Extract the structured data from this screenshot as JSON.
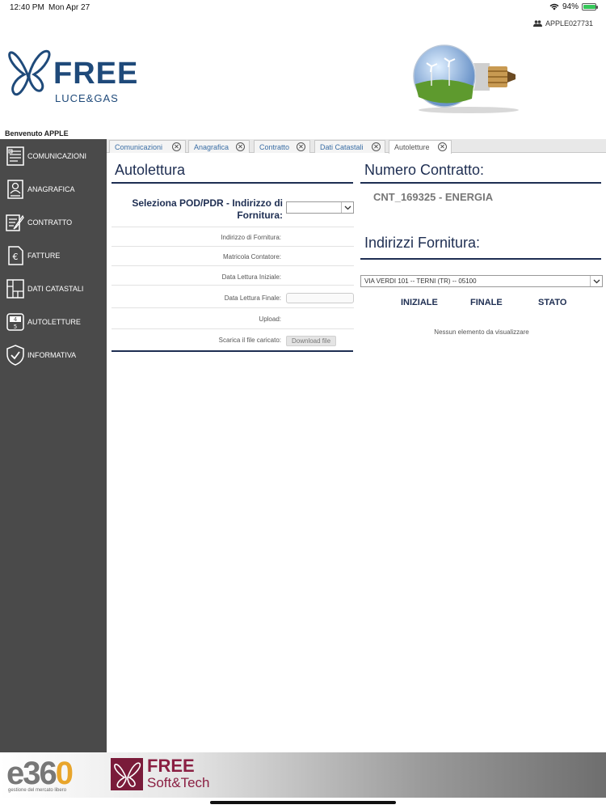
{
  "status_bar": {
    "time": "12:40 PM",
    "date": "Mon Apr 27",
    "battery": "94%",
    "battery_level": 0.94
  },
  "header": {
    "user_id": "APPLE027731",
    "brand_name": "FREE",
    "brand_tagline": "LUCE&GAS",
    "welcome": "Benvenuto APPLE"
  },
  "sidebar": {
    "items": [
      {
        "label": "COMUNICAZIONI",
        "icon": "document-list-icon"
      },
      {
        "label": "ANAGRAFICA",
        "icon": "user-card-icon"
      },
      {
        "label": "CONTRATTO",
        "icon": "contract-pen-icon"
      },
      {
        "label": "FATTURE",
        "icon": "euro-invoice-icon"
      },
      {
        "label": "DATI CATASTALI",
        "icon": "cadastral-map-icon"
      },
      {
        "label": "AUTOLETTURE",
        "icon": "meter-reading-icon"
      },
      {
        "label": "INFORMATIVA",
        "icon": "shield-check-icon"
      }
    ]
  },
  "tabs": [
    {
      "label": "Comunicazioni",
      "active": false
    },
    {
      "label": "Anagrafica",
      "active": false
    },
    {
      "label": "Contratto",
      "active": false
    },
    {
      "label": "Dati Catastali",
      "active": false
    },
    {
      "label": "Autoletture",
      "active": true
    }
  ],
  "autolettura": {
    "title": "Autolettura",
    "pod_label": "Seleziona POD/PDR - Indirizzo di Fornitura:",
    "pod_value": "",
    "fields": {
      "indirizzo": "Indirizzo di Fornitura:",
      "matricola": "Matricola Contatore:",
      "data_iniziale": "Data Lettura Iniziale:",
      "data_finale": "Data Lettura Finale:",
      "upload": "Upload:",
      "scarica": "Scarica il file caricato:"
    },
    "download_label": "Download file"
  },
  "contratto": {
    "title": "Numero Contratto:",
    "value": "CNT_169325 - ENERGIA",
    "addresses_title": "Indirizzi Fornitura:",
    "address_selected": "VIA VERDI 101 -- TERNI (TR) -- 05100",
    "columns": [
      "INIZIALE",
      "FINALE",
      "STATO"
    ],
    "empty_message": "Nessun elemento da visualizzare"
  },
  "footer": {
    "e360_text": "e360",
    "e360_tagline": "gestione del mercato libero",
    "fst_brand": "FREE",
    "fst_tagline": "Soft&Tech"
  },
  "colors": {
    "navy": "#1e2e52",
    "brand_blue": "#1f4a7a",
    "sidebar": "#4a4a4a",
    "tab_link": "#3a6ea5",
    "footer_brand": "#8a1f42"
  }
}
